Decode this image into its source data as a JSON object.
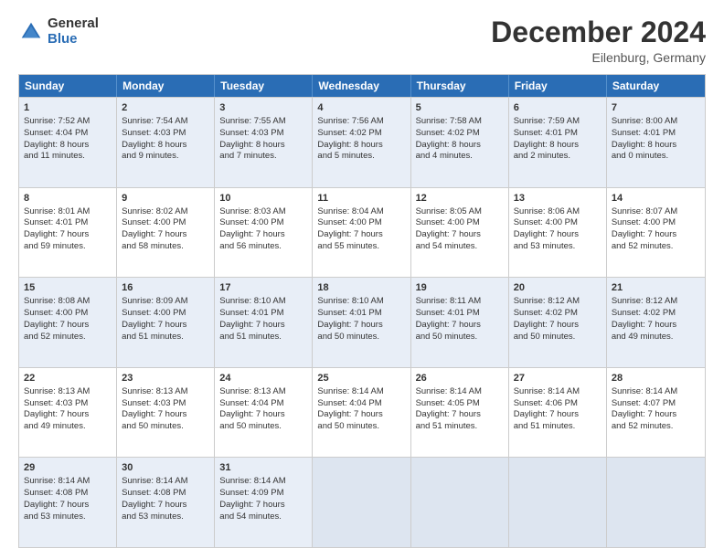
{
  "logo": {
    "general": "General",
    "blue": "Blue"
  },
  "title": "December 2024",
  "subtitle": "Eilenburg, Germany",
  "days": [
    "Sunday",
    "Monday",
    "Tuesday",
    "Wednesday",
    "Thursday",
    "Friday",
    "Saturday"
  ],
  "rows": [
    [
      {
        "day": "1",
        "lines": [
          "Sunrise: 7:52 AM",
          "Sunset: 4:04 PM",
          "Daylight: 8 hours",
          "and 11 minutes."
        ]
      },
      {
        "day": "2",
        "lines": [
          "Sunrise: 7:54 AM",
          "Sunset: 4:03 PM",
          "Daylight: 8 hours",
          "and 9 minutes."
        ]
      },
      {
        "day": "3",
        "lines": [
          "Sunrise: 7:55 AM",
          "Sunset: 4:03 PM",
          "Daylight: 8 hours",
          "and 7 minutes."
        ]
      },
      {
        "day": "4",
        "lines": [
          "Sunrise: 7:56 AM",
          "Sunset: 4:02 PM",
          "Daylight: 8 hours",
          "and 5 minutes."
        ]
      },
      {
        "day": "5",
        "lines": [
          "Sunrise: 7:58 AM",
          "Sunset: 4:02 PM",
          "Daylight: 8 hours",
          "and 4 minutes."
        ]
      },
      {
        "day": "6",
        "lines": [
          "Sunrise: 7:59 AM",
          "Sunset: 4:01 PM",
          "Daylight: 8 hours",
          "and 2 minutes."
        ]
      },
      {
        "day": "7",
        "lines": [
          "Sunrise: 8:00 AM",
          "Sunset: 4:01 PM",
          "Daylight: 8 hours",
          "and 0 minutes."
        ]
      }
    ],
    [
      {
        "day": "8",
        "lines": [
          "Sunrise: 8:01 AM",
          "Sunset: 4:01 PM",
          "Daylight: 7 hours",
          "and 59 minutes."
        ]
      },
      {
        "day": "9",
        "lines": [
          "Sunrise: 8:02 AM",
          "Sunset: 4:00 PM",
          "Daylight: 7 hours",
          "and 58 minutes."
        ]
      },
      {
        "day": "10",
        "lines": [
          "Sunrise: 8:03 AM",
          "Sunset: 4:00 PM",
          "Daylight: 7 hours",
          "and 56 minutes."
        ]
      },
      {
        "day": "11",
        "lines": [
          "Sunrise: 8:04 AM",
          "Sunset: 4:00 PM",
          "Daylight: 7 hours",
          "and 55 minutes."
        ]
      },
      {
        "day": "12",
        "lines": [
          "Sunrise: 8:05 AM",
          "Sunset: 4:00 PM",
          "Daylight: 7 hours",
          "and 54 minutes."
        ]
      },
      {
        "day": "13",
        "lines": [
          "Sunrise: 8:06 AM",
          "Sunset: 4:00 PM",
          "Daylight: 7 hours",
          "and 53 minutes."
        ]
      },
      {
        "day": "14",
        "lines": [
          "Sunrise: 8:07 AM",
          "Sunset: 4:00 PM",
          "Daylight: 7 hours",
          "and 52 minutes."
        ]
      }
    ],
    [
      {
        "day": "15",
        "lines": [
          "Sunrise: 8:08 AM",
          "Sunset: 4:00 PM",
          "Daylight: 7 hours",
          "and 52 minutes."
        ]
      },
      {
        "day": "16",
        "lines": [
          "Sunrise: 8:09 AM",
          "Sunset: 4:00 PM",
          "Daylight: 7 hours",
          "and 51 minutes."
        ]
      },
      {
        "day": "17",
        "lines": [
          "Sunrise: 8:10 AM",
          "Sunset: 4:01 PM",
          "Daylight: 7 hours",
          "and 51 minutes."
        ]
      },
      {
        "day": "18",
        "lines": [
          "Sunrise: 8:10 AM",
          "Sunset: 4:01 PM",
          "Daylight: 7 hours",
          "and 50 minutes."
        ]
      },
      {
        "day": "19",
        "lines": [
          "Sunrise: 8:11 AM",
          "Sunset: 4:01 PM",
          "Daylight: 7 hours",
          "and 50 minutes."
        ]
      },
      {
        "day": "20",
        "lines": [
          "Sunrise: 8:12 AM",
          "Sunset: 4:02 PM",
          "Daylight: 7 hours",
          "and 50 minutes."
        ]
      },
      {
        "day": "21",
        "lines": [
          "Sunrise: 8:12 AM",
          "Sunset: 4:02 PM",
          "Daylight: 7 hours",
          "and 49 minutes."
        ]
      }
    ],
    [
      {
        "day": "22",
        "lines": [
          "Sunrise: 8:13 AM",
          "Sunset: 4:03 PM",
          "Daylight: 7 hours",
          "and 49 minutes."
        ]
      },
      {
        "day": "23",
        "lines": [
          "Sunrise: 8:13 AM",
          "Sunset: 4:03 PM",
          "Daylight: 7 hours",
          "and 50 minutes."
        ]
      },
      {
        "day": "24",
        "lines": [
          "Sunrise: 8:13 AM",
          "Sunset: 4:04 PM",
          "Daylight: 7 hours",
          "and 50 minutes."
        ]
      },
      {
        "day": "25",
        "lines": [
          "Sunrise: 8:14 AM",
          "Sunset: 4:04 PM",
          "Daylight: 7 hours",
          "and 50 minutes."
        ]
      },
      {
        "day": "26",
        "lines": [
          "Sunrise: 8:14 AM",
          "Sunset: 4:05 PM",
          "Daylight: 7 hours",
          "and 51 minutes."
        ]
      },
      {
        "day": "27",
        "lines": [
          "Sunrise: 8:14 AM",
          "Sunset: 4:06 PM",
          "Daylight: 7 hours",
          "and 51 minutes."
        ]
      },
      {
        "day": "28",
        "lines": [
          "Sunrise: 8:14 AM",
          "Sunset: 4:07 PM",
          "Daylight: 7 hours",
          "and 52 minutes."
        ]
      }
    ],
    [
      {
        "day": "29",
        "lines": [
          "Sunrise: 8:14 AM",
          "Sunset: 4:08 PM",
          "Daylight: 7 hours",
          "and 53 minutes."
        ]
      },
      {
        "day": "30",
        "lines": [
          "Sunrise: 8:14 AM",
          "Sunset: 4:08 PM",
          "Daylight: 7 hours",
          "and 53 minutes."
        ]
      },
      {
        "day": "31",
        "lines": [
          "Sunrise: 8:14 AM",
          "Sunset: 4:09 PM",
          "Daylight: 7 hours",
          "and 54 minutes."
        ]
      },
      null,
      null,
      null,
      null
    ]
  ],
  "alt_rows": [
    0,
    2,
    4
  ]
}
